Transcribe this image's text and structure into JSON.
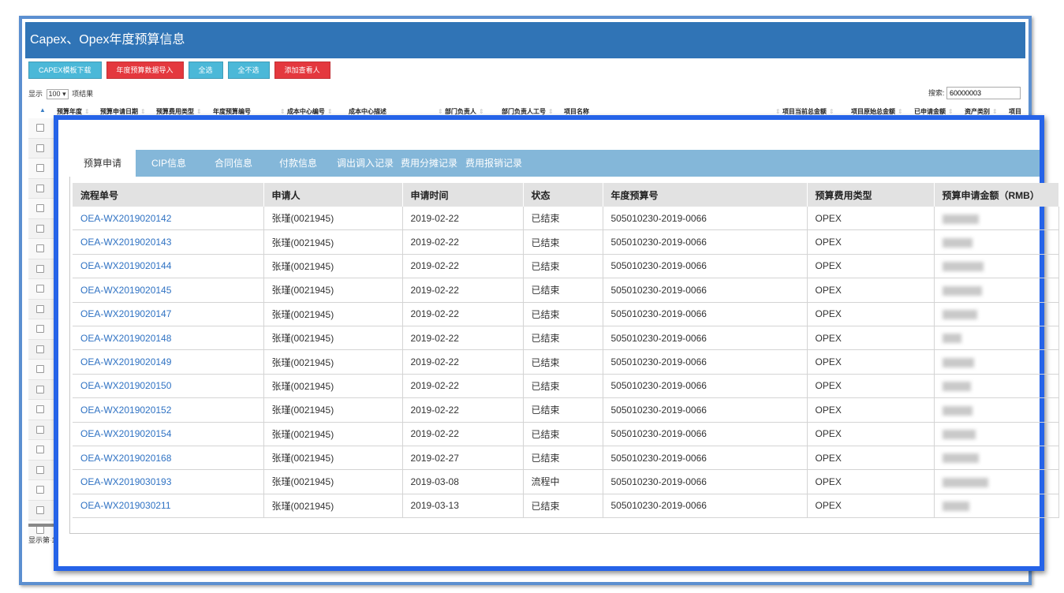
{
  "background": {
    "title": "Capex、Opex年度预算信息",
    "toolbar": [
      {
        "label": "CAPEX模板下载",
        "color": "#4bb8d8"
      },
      {
        "label": "年度预算数据导入",
        "color": "#e4383e"
      },
      {
        "label": "全选",
        "color": "#4bb8d8"
      },
      {
        "label": "全不选",
        "color": "#4bb8d8"
      },
      {
        "label": "添加查看人",
        "color": "#e4383e"
      }
    ],
    "show_prefix": "显示",
    "page_size": "100",
    "show_suffix": "项结果",
    "search_label": "搜索:",
    "search_value": "60000003",
    "columns": [
      "预算年度",
      "预算申请日期",
      "预算费用类型",
      "年度预算编号",
      "成本中心编号",
      "成本中心描述",
      "部门负责人",
      "部门负责人工号",
      "项目名称",
      "项目当前总金额",
      "项目原始总金额",
      "已申请金额",
      "资产类别",
      "项目"
    ],
    "footer": "显示第 1"
  },
  "dialog": {
    "tabs": [
      {
        "label": "预算申请",
        "active": true
      },
      {
        "label": "CIP信息"
      },
      {
        "label": "合同信息"
      },
      {
        "label": "付款信息"
      },
      {
        "label": "调出调入记录"
      },
      {
        "label": "费用分摊记录"
      },
      {
        "label": "费用报销记录"
      }
    ],
    "columns": [
      "流程单号",
      "申请人",
      "申请时间",
      "状态",
      "年度预算号",
      "预算费用类型",
      "预算申请金额（RMB）"
    ],
    "rows": [
      {
        "id": "OEA-WX2019020142",
        "applicant": "张瑾(0021945)",
        "date": "2019-02-22",
        "status": "已结束",
        "budget_no": "505010230-2019-0066",
        "type": "OPEX"
      },
      {
        "id": "OEA-WX2019020143",
        "applicant": "张瑾(0021945)",
        "date": "2019-02-22",
        "status": "已结束",
        "budget_no": "505010230-2019-0066",
        "type": "OPEX"
      },
      {
        "id": "OEA-WX2019020144",
        "applicant": "张瑾(0021945)",
        "date": "2019-02-22",
        "status": "已结束",
        "budget_no": "505010230-2019-0066",
        "type": "OPEX"
      },
      {
        "id": "OEA-WX2019020145",
        "applicant": "张瑾(0021945)",
        "date": "2019-02-22",
        "status": "已结束",
        "budget_no": "505010230-2019-0066",
        "type": "OPEX"
      },
      {
        "id": "OEA-WX2019020147",
        "applicant": "张瑾(0021945)",
        "date": "2019-02-22",
        "status": "已结束",
        "budget_no": "505010230-2019-0066",
        "type": "OPEX"
      },
      {
        "id": "OEA-WX2019020148",
        "applicant": "张瑾(0021945)",
        "date": "2019-02-22",
        "status": "已结束",
        "budget_no": "505010230-2019-0066",
        "type": "OPEX"
      },
      {
        "id": "OEA-WX2019020149",
        "applicant": "张瑾(0021945)",
        "date": "2019-02-22",
        "status": "已结束",
        "budget_no": "505010230-2019-0066",
        "type": "OPEX"
      },
      {
        "id": "OEA-WX2019020150",
        "applicant": "张瑾(0021945)",
        "date": "2019-02-22",
        "status": "已结束",
        "budget_no": "505010230-2019-0066",
        "type": "OPEX"
      },
      {
        "id": "OEA-WX2019020152",
        "applicant": "张瑾(0021945)",
        "date": "2019-02-22",
        "status": "已结束",
        "budget_no": "505010230-2019-0066",
        "type": "OPEX"
      },
      {
        "id": "OEA-WX2019020154",
        "applicant": "张瑾(0021945)",
        "date": "2019-02-22",
        "status": "已结束",
        "budget_no": "505010230-2019-0066",
        "type": "OPEX"
      },
      {
        "id": "OEA-WX2019020168",
        "applicant": "张瑾(0021945)",
        "date": "2019-02-27",
        "status": "已结束",
        "budget_no": "505010230-2019-0066",
        "type": "OPEX"
      },
      {
        "id": "OEA-WX2019030193",
        "applicant": "张瑾(0021945)",
        "date": "2019-03-08",
        "status": "流程中",
        "budget_no": "505010230-2019-0066",
        "type": "OPEX"
      },
      {
        "id": "OEA-WX2019030211",
        "applicant": "张瑾(0021945)",
        "date": "2019-03-13",
        "status": "已结束",
        "budget_no": "505010230-2019-0066",
        "type": "OPEX"
      }
    ],
    "link_color": "#2f72c3",
    "tab_bar_color": "#84b7d9",
    "frame_color": "#2563e8"
  }
}
